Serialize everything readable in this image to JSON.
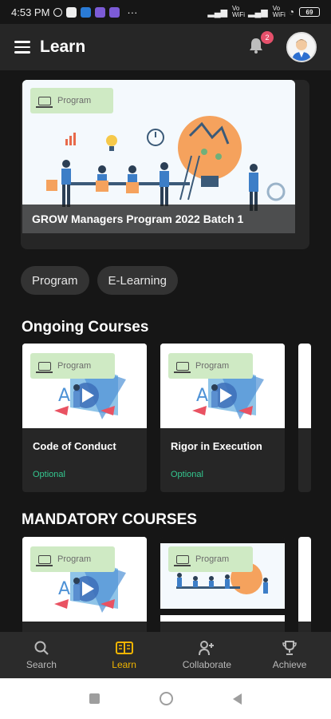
{
  "status_bar": {
    "time": "4:53 PM",
    "signal_1": "Vo WiFi",
    "signal_2": "Vo WiFi",
    "battery": "69"
  },
  "header": {
    "title": "Learn",
    "notification_count": "2"
  },
  "featured": {
    "badge": "Program",
    "title": "GROW Managers Program 2022 Batch 1"
  },
  "filters": [
    "Program",
    "E-Learning"
  ],
  "ongoing": {
    "title": "Ongoing Courses",
    "courses": [
      {
        "badge": "Program",
        "title": "Code of Conduct",
        "tag": "Optional"
      },
      {
        "badge": "Program",
        "title": "Rigor in Execution",
        "tag": "Optional"
      }
    ]
  },
  "mandatory": {
    "title": "MANDATORY COURSES",
    "courses": [
      {
        "badge": "Program"
      },
      {
        "badge": "Program"
      }
    ]
  },
  "bottom_nav": [
    {
      "label": "Search",
      "icon": "search-icon"
    },
    {
      "label": "Learn",
      "icon": "book-icon",
      "active": true
    },
    {
      "label": "Collaborate",
      "icon": "add-user-icon"
    },
    {
      "label": "Achieve",
      "icon": "trophy-icon"
    }
  ],
  "colors": {
    "accent": "#f0b400",
    "tag": "#34c78f",
    "badge_bg": "#cfeac4",
    "notification": "#e5506b"
  }
}
